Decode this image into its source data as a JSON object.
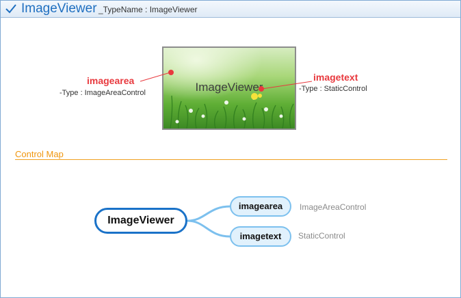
{
  "header": {
    "title": "ImageViewer",
    "subtitle": "_TypeName : ImageViewer",
    "icon": "check-icon"
  },
  "preview": {
    "overlay_text": "ImageViewer",
    "callouts": [
      {
        "name": "imagearea",
        "type": "-Type : ImageAreaControl"
      },
      {
        "name": "imagetext",
        "type": "-Type : StaticControl"
      }
    ]
  },
  "control_map": {
    "section_title": "Control Map",
    "root": "ImageViewer",
    "children": [
      {
        "name": "imagearea",
        "type": "ImageAreaControl"
      },
      {
        "name": "imagetext",
        "type": "StaticControl"
      }
    ]
  },
  "colors": {
    "accent": "#1f6fc0",
    "callout": "#e8393e",
    "section": "#f0960e",
    "node_fill": "#e1f1fc",
    "node_border": "#7cc0ee"
  }
}
